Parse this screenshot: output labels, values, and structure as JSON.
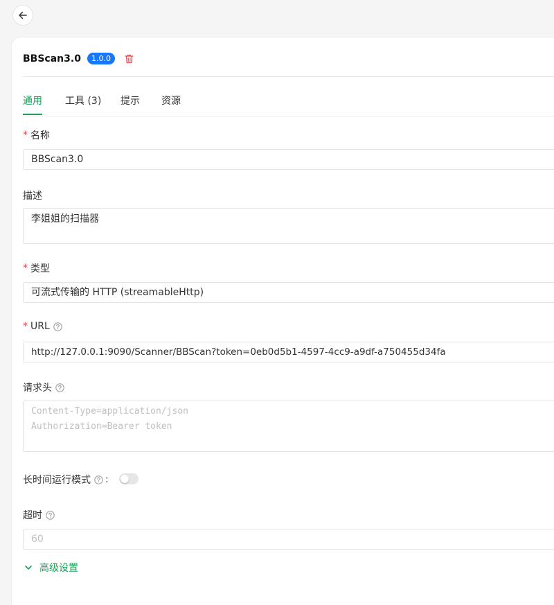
{
  "header": {
    "title": "BBScan3.0",
    "version": "1.0.0"
  },
  "tabs": [
    {
      "label": "通用"
    },
    {
      "label": "工具 (3)"
    },
    {
      "label": "提示"
    },
    {
      "label": "资源"
    }
  ],
  "form": {
    "name": {
      "label": "名称",
      "value": "BBScan3.0"
    },
    "description": {
      "label": "描述",
      "value": "李姐姐的扫描器"
    },
    "type": {
      "label": "类型",
      "value": "可流式传输的 HTTP (streamableHttp)"
    },
    "url": {
      "label": "URL",
      "value": "http://127.0.0.1:9090/Scanner/BBScan?token=0eb0d5b1-4597-4cc9-a9df-a750455d34fa"
    },
    "headers": {
      "label": "请求头",
      "placeholder_line1": "Content-Type=application/json",
      "placeholder_line2": "Authorization=Bearer token"
    },
    "long_running": {
      "label": "长时间运行模式",
      "colon": ":",
      "enabled": false
    },
    "timeout": {
      "label": "超时",
      "placeholder": "60"
    },
    "advanced": {
      "label": "高级设置"
    }
  },
  "colors": {
    "accent": "#18a058",
    "badge": "#1677ff",
    "danger": "#e5484d"
  },
  "icons": {
    "back": "arrow-left-icon",
    "delete": "trash-icon",
    "help": "question-circle-icon",
    "expand": "chevron-down-icon"
  }
}
